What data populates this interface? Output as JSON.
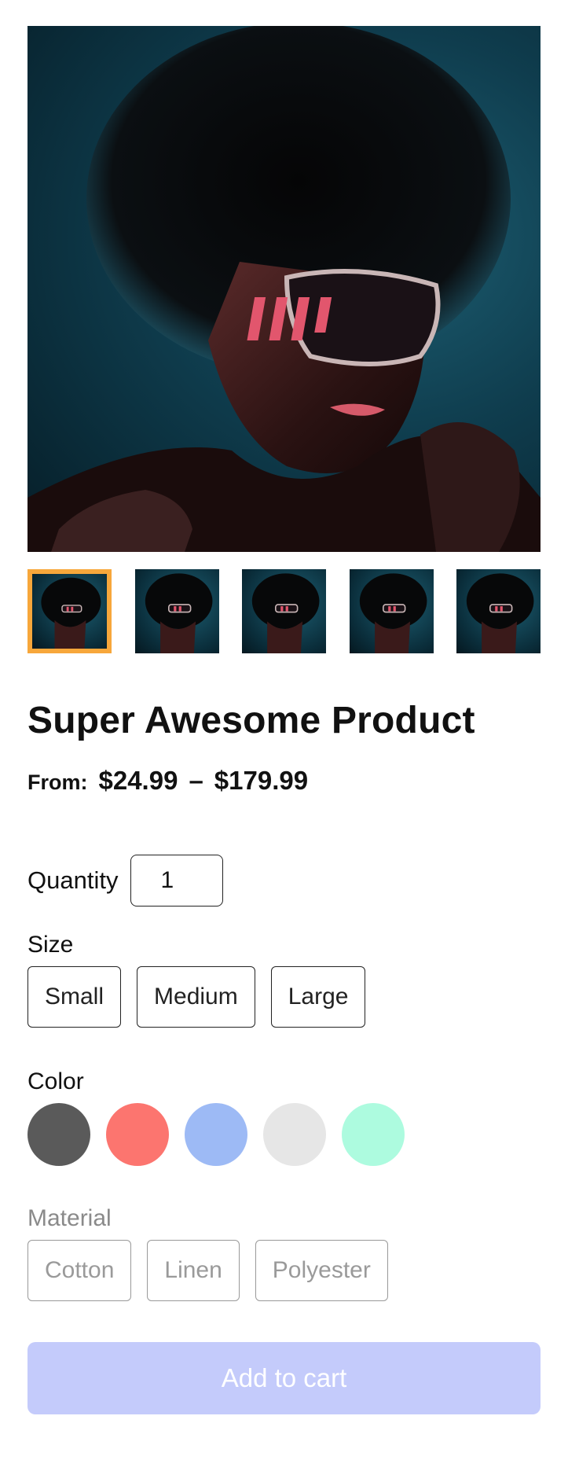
{
  "gallery": {
    "main_image": "product-photo-woman-sunglasses",
    "thumbnails": [
      "thumbnail-1",
      "thumbnail-2",
      "thumbnail-3",
      "thumbnail-4",
      "thumbnail-5"
    ],
    "selected_index": 0,
    "selected_color": "#f7a73b"
  },
  "product": {
    "title": "Super Awesome Product",
    "price_from_label": "From:",
    "price_min": "$24.99",
    "price_separator": "–",
    "price_max": "$179.99"
  },
  "quantity": {
    "label": "Quantity",
    "value": "1"
  },
  "size": {
    "label": "Size",
    "options": [
      "Small",
      "Medium",
      "Large"
    ]
  },
  "color": {
    "label": "Color",
    "swatches": [
      "#5a5a5a",
      "#fc756f",
      "#9dbaf5",
      "#e6e6e6",
      "#adfbdf"
    ]
  },
  "material": {
    "label": "Material",
    "options": [
      "Cotton",
      "Linen",
      "Polyester"
    ]
  },
  "cart": {
    "label": "Add to cart",
    "background": "#c4cbfb"
  }
}
